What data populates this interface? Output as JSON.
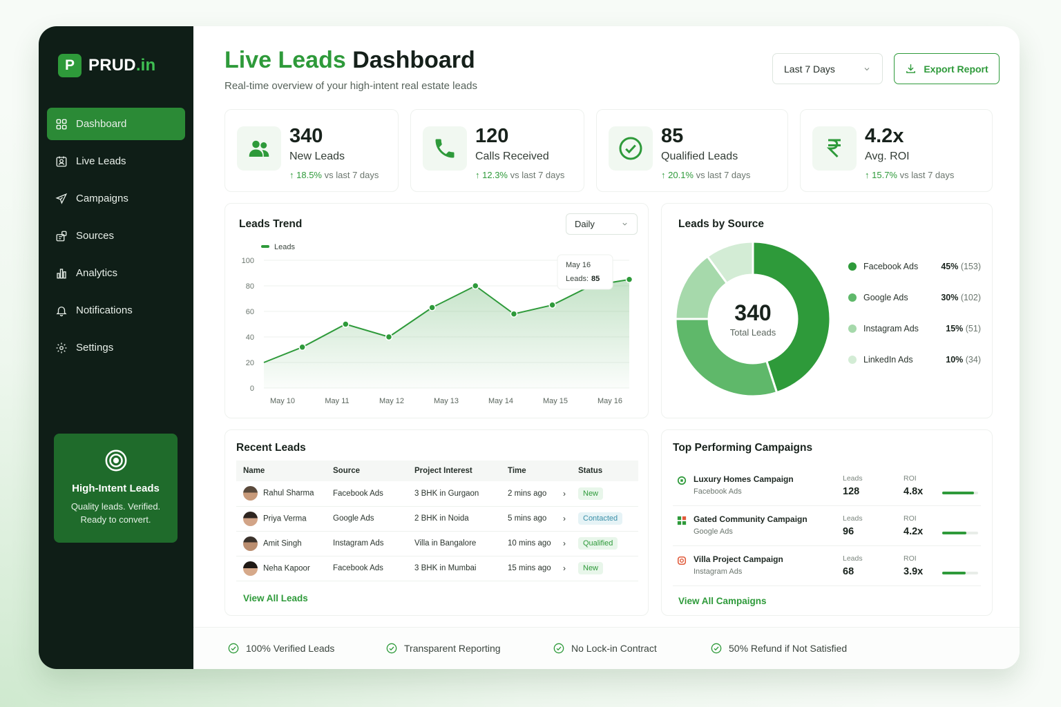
{
  "brand": {
    "mark": "P",
    "name": "PRUD",
    "suffix": ".in"
  },
  "sidebar": {
    "items": [
      {
        "label": "Dashboard"
      },
      {
        "label": "Live Leads"
      },
      {
        "label": "Campaigns"
      },
      {
        "label": "Sources"
      },
      {
        "label": "Analytics"
      },
      {
        "label": "Notifications"
      },
      {
        "label": "Settings"
      }
    ],
    "promo": {
      "title": "High-Intent Leads",
      "text": "Quality leads. Verified. Ready to convert."
    }
  },
  "header": {
    "title_accent": "Live Leads",
    "title_rest": " Dashboard",
    "subtitle": "Real-time overview of your high-intent real estate leads",
    "range": "Last 7 Days",
    "export": "Export Report"
  },
  "stats": [
    {
      "value": "340",
      "label": "New Leads",
      "change": "18.5%",
      "suffix": "vs last 7 days"
    },
    {
      "value": "120",
      "label": "Calls Received",
      "change": "12.3%",
      "suffix": "vs last 7 days"
    },
    {
      "value": "85",
      "label": "Qualified Leads",
      "change": "20.1%",
      "suffix": "vs last 7 days"
    },
    {
      "value": "4.2x",
      "label": "Avg. ROI",
      "change": "15.7%",
      "suffix": "vs last 7 days"
    }
  ],
  "trend": {
    "title": "Leads Trend",
    "interval": "Daily",
    "tooltip": {
      "date": "May 16",
      "label": "Leads:",
      "value": "85"
    }
  },
  "source": {
    "title": "Leads by Source",
    "total": "340",
    "total_label": "Total Leads"
  },
  "chart_data": [
    {
      "type": "area",
      "title": "Leads Trend",
      "categories": [
        "May 10",
        "May 11",
        "May 12",
        "May 13",
        "May 14",
        "May 15",
        "May 16"
      ],
      "x": [
        0,
        0.8,
        1.7,
        2.6,
        3.5,
        4.4,
        5.2,
        6.0,
        6.8,
        7.6
      ],
      "series": [
        {
          "name": "Leads",
          "values": [
            20,
            32,
            50,
            40,
            63,
            80,
            58,
            65,
            80,
            85
          ]
        }
      ],
      "ylim": [
        0,
        100
      ],
      "yticks": [
        0,
        20,
        40,
        60,
        80,
        100
      ],
      "grid": true,
      "legend": "top-left",
      "color": "#2e9a3a"
    },
    {
      "type": "pie",
      "title": "Leads by Source",
      "labels": [
        "Facebook Ads",
        "Google Ads",
        "Instagram Ads",
        "LinkedIn Ads"
      ],
      "values": [
        45,
        30,
        15,
        10
      ],
      "counts": [
        153,
        102,
        51,
        34
      ],
      "display": [
        "45%",
        "30%",
        "15%",
        "10%"
      ],
      "display_counts": [
        "(153)",
        "(102)",
        "(51)",
        "(34)"
      ],
      "colors": [
        "#2e9a3a",
        "#5fb86a",
        "#a6d9ab",
        "#d3ecd5"
      ],
      "legend": "right"
    }
  ],
  "recent": {
    "title": "Recent Leads",
    "columns": [
      "Name",
      "Source",
      "Project Interest",
      "Time",
      "Status"
    ],
    "rows": [
      {
        "name": "Rahul Sharma",
        "source": "Facebook Ads",
        "project": "3 BHK in Gurgaon",
        "time": "2 mins ago",
        "status": "New"
      },
      {
        "name": "Priya Verma",
        "source": "Google Ads",
        "project": "2 BHK in Noida",
        "time": "5 mins ago",
        "status": "Contacted"
      },
      {
        "name": "Amit Singh",
        "source": "Instagram Ads",
        "project": "Villa in Bangalore",
        "time": "10 mins ago",
        "status": "Qualified"
      },
      {
        "name": "Neha Kapoor",
        "source": "Facebook Ads",
        "project": "3 BHK in Mumbai",
        "time": "15 mins ago",
        "status": "New"
      }
    ],
    "view_all": "View All Leads"
  },
  "campaigns": {
    "title": "Top Performing Campaigns",
    "leads_label": "Leads",
    "roi_label": "ROI",
    "rows": [
      {
        "name": "Luxury Homes Campaign",
        "source": "Facebook Ads",
        "leads": "128",
        "roi": "4.8x",
        "roi_level": 0.88
      },
      {
        "name": "Gated Community Campaign",
        "source": "Google Ads",
        "leads": "96",
        "roi": "4.2x",
        "roi_level": 0.68
      },
      {
        "name": "Villa Project Campaign",
        "source": "Instagram Ads",
        "leads": "68",
        "roi": "3.9x",
        "roi_level": 0.66
      }
    ],
    "view_all": "View All Campaigns"
  },
  "footer": [
    {
      "label": "100% Verified Leads"
    },
    {
      "label": "Transparent Reporting"
    },
    {
      "label": "No Lock-in Contract"
    },
    {
      "label": "50% Refund if Not Satisfied"
    }
  ],
  "colors": {
    "accent": "#2e9a3a",
    "sidebar": "#0f1e17",
    "promo": "#1f6b2b"
  }
}
